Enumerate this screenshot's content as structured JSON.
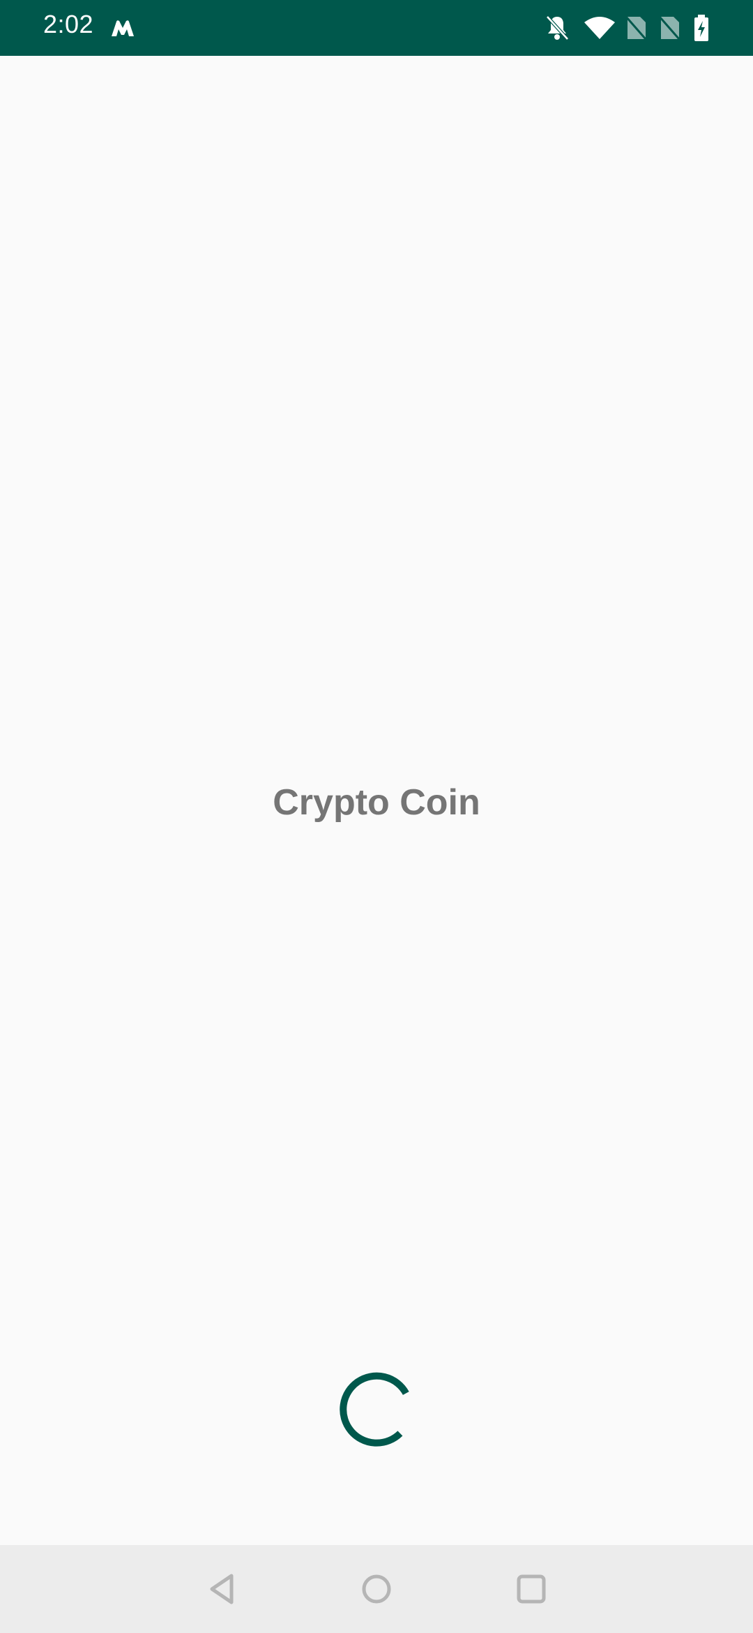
{
  "status_bar": {
    "time": "2:02",
    "background_color": "#00584c",
    "icons": [
      "app-logo-icon",
      "notifications-muted-icon",
      "wifi-icon",
      "sim-no-signal-icon",
      "sim-no-signal-icon",
      "battery-charging-icon"
    ]
  },
  "splash": {
    "app_name": "Crypto Coin",
    "title_color": "#757575",
    "spinner_color": "#00584c",
    "loading": true
  },
  "nav_bar": {
    "background_color": "#ececec",
    "buttons": [
      "back-icon",
      "home-icon",
      "recents-icon"
    ]
  }
}
